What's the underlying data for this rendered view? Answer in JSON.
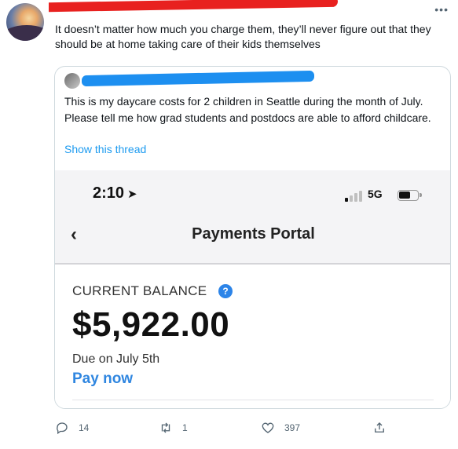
{
  "tweet": {
    "text": "It doesn’t matter how much you charge them, they’ll never figure out that they should be at home taking care of their kids themselves",
    "more_icon": "more-horizontal-icon"
  },
  "quoted": {
    "text": "This is my daycare costs for 2 children in Seattle during the month of July. Please tell me how grad students and postdocs are able to afford childcare.",
    "show_thread": "Show this thread",
    "screenshot": {
      "time": "2:10",
      "network": "5G",
      "title": "Payments Portal",
      "balance_label": "CURRENT BALANCE",
      "amount": "$5,922.00",
      "due": "Due on July 5th",
      "pay_now": "Pay now"
    }
  },
  "actions": {
    "replies": "14",
    "retweets": "1",
    "likes": "397"
  },
  "colors": {
    "redaction_red": "#e8211f",
    "redaction_blue": "#1d8ff0",
    "link": "#1d9bf0",
    "pay_link": "#2f86e0"
  }
}
